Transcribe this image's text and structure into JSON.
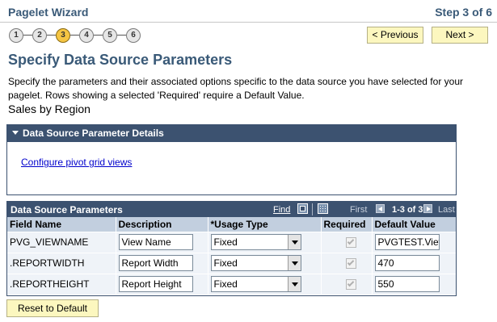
{
  "header": {
    "title": "Pagelet Wizard",
    "step_label": "Step 3 of 6"
  },
  "steps": [
    {
      "label": "1",
      "active": false
    },
    {
      "label": "2",
      "active": false
    },
    {
      "label": "3",
      "active": true
    },
    {
      "label": "4",
      "active": false
    },
    {
      "label": "5",
      "active": false
    },
    {
      "label": "6",
      "active": false
    }
  ],
  "nav": {
    "previous_label": "< Previous",
    "next_label": "Next >"
  },
  "page": {
    "title": "Specify Data Source Parameters",
    "description": "Specify the parameters and their associated options specific to the data source you have selected for your pagelet.  Rows showing a selected 'Required' require a Default Value.",
    "data_source_name": "Sales by Region"
  },
  "details_panel": {
    "title": "Data Source Parameter Details",
    "link_label": "Configure pivot grid views"
  },
  "grid": {
    "title": "Data Source Parameters",
    "find_label": "Find",
    "first_label": "First",
    "count_label": "1-3 of 3",
    "last_label": "Last",
    "columns": [
      "Field Name",
      "Description",
      "*Usage Type",
      "Required",
      "Default Value"
    ],
    "rows": [
      {
        "field": "PVG_VIEWNAME",
        "description": "View Name",
        "usage": "Fixed",
        "required": true,
        "default": "PVGTEST.View"
      },
      {
        "field": ".REPORTWIDTH",
        "description": "Report Width",
        "usage": "Fixed",
        "required": true,
        "default": "470"
      },
      {
        "field": ".REPORTHEIGHT",
        "description": "Report Height",
        "usage": "Fixed",
        "required": true,
        "default": "550"
      }
    ]
  },
  "reset_label": "Reset to Default",
  "colors": {
    "accent": "#3a5a78",
    "panel_header": "#3c5270",
    "button_bg": "#fcf7bf",
    "active_step": "#f5c543"
  }
}
